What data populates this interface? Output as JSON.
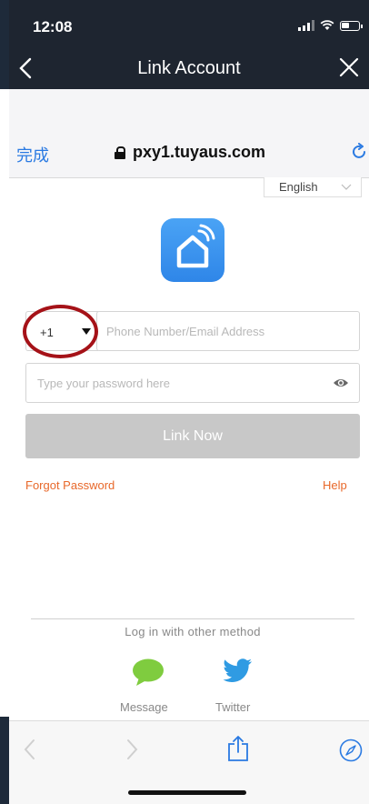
{
  "status": {
    "time": "12:08"
  },
  "nav": {
    "title": "Link Account"
  },
  "browser": {
    "done_label": "完成",
    "url": "pxy1.tuyaus.com"
  },
  "language": {
    "selected": "English"
  },
  "form": {
    "country_code": "+1",
    "phone_placeholder": "Phone Number/Email Address",
    "password_placeholder": "Type your password here",
    "link_button": "Link Now",
    "forgot_label": "Forgot Password",
    "help_label": "Help"
  },
  "other_login": {
    "heading": "Log in with other method",
    "methods": [
      {
        "label": "Message",
        "icon": "message-icon"
      },
      {
        "label": "Twitter",
        "icon": "twitter-icon"
      }
    ]
  },
  "colors": {
    "accent_link": "#2a7ae2",
    "orange_text": "#e8682a",
    "disabled_button": "#c8c8c8",
    "message_green": "#7fcc3f",
    "twitter_blue": "#2f9be3",
    "highlight_circle": "#a51218"
  }
}
